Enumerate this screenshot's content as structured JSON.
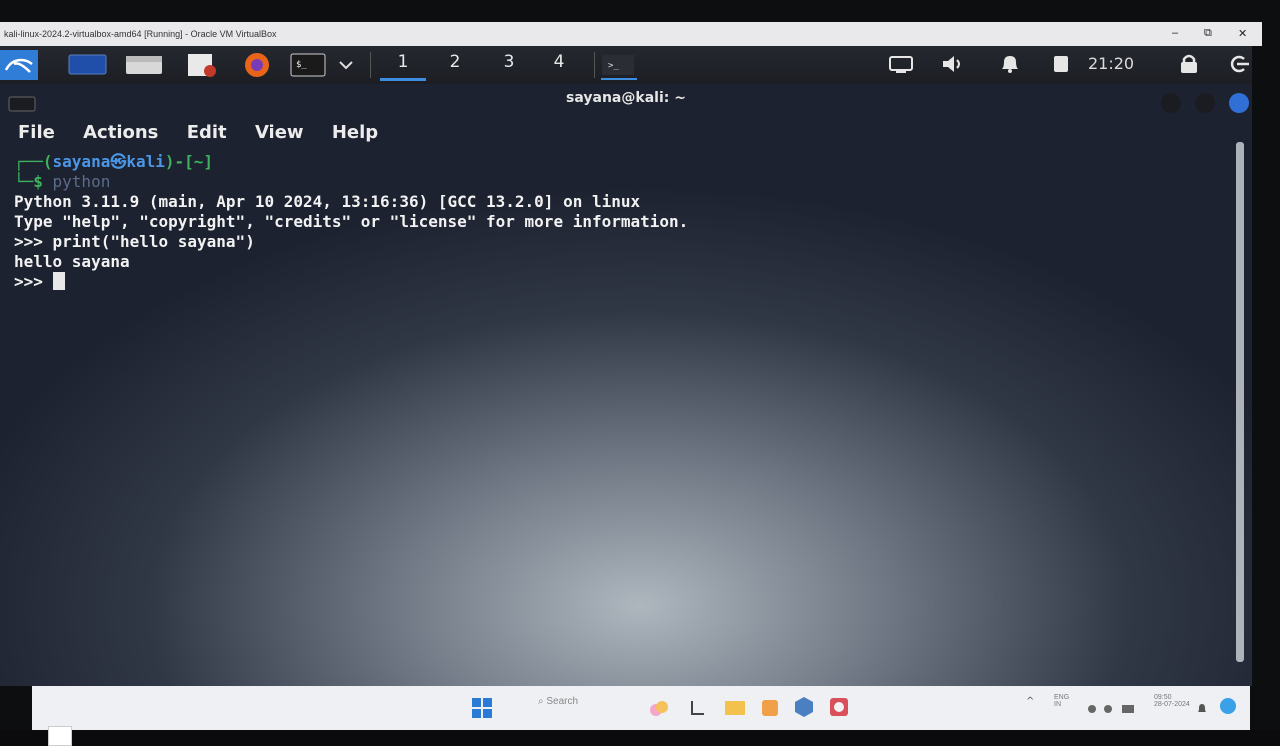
{
  "vbox": {
    "title": "kali-linux-2024.2-virtualbox-amd64 [Running] - Oracle VM VirtualBox",
    "minimize": "–",
    "restore": "⧉",
    "close": "✕"
  },
  "panel": {
    "workspaces": [
      "1",
      "2",
      "3",
      "4"
    ],
    "active_workspace": "1",
    "clock": "21:20"
  },
  "terminal": {
    "window_title": "sayana@kali: ~",
    "menu": [
      "File",
      "Actions",
      "Edit",
      "View",
      "Help"
    ],
    "prompt_open": "┌──(",
    "prompt_user": "sayana㉿kali",
    "prompt_close": ")-[~]",
    "prompt_dollar": "└─$ ",
    "command": "python",
    "lines": [
      "Python 3.11.9 (main, Apr 10 2024, 13:16:36) [GCC 13.2.0] on linux",
      "Type \"help\", \"copyright\", \"credits\" or \"license\" for more information.",
      ">>> print(\"hello sayana\")",
      "hello sayana"
    ],
    "repl_prompt": ">>> "
  },
  "host_taskbar": {
    "search_placeholder": "Search",
    "lang_1": "ENG",
    "lang_2": "IN",
    "time": "09:50",
    "date": "28-07-2024"
  }
}
